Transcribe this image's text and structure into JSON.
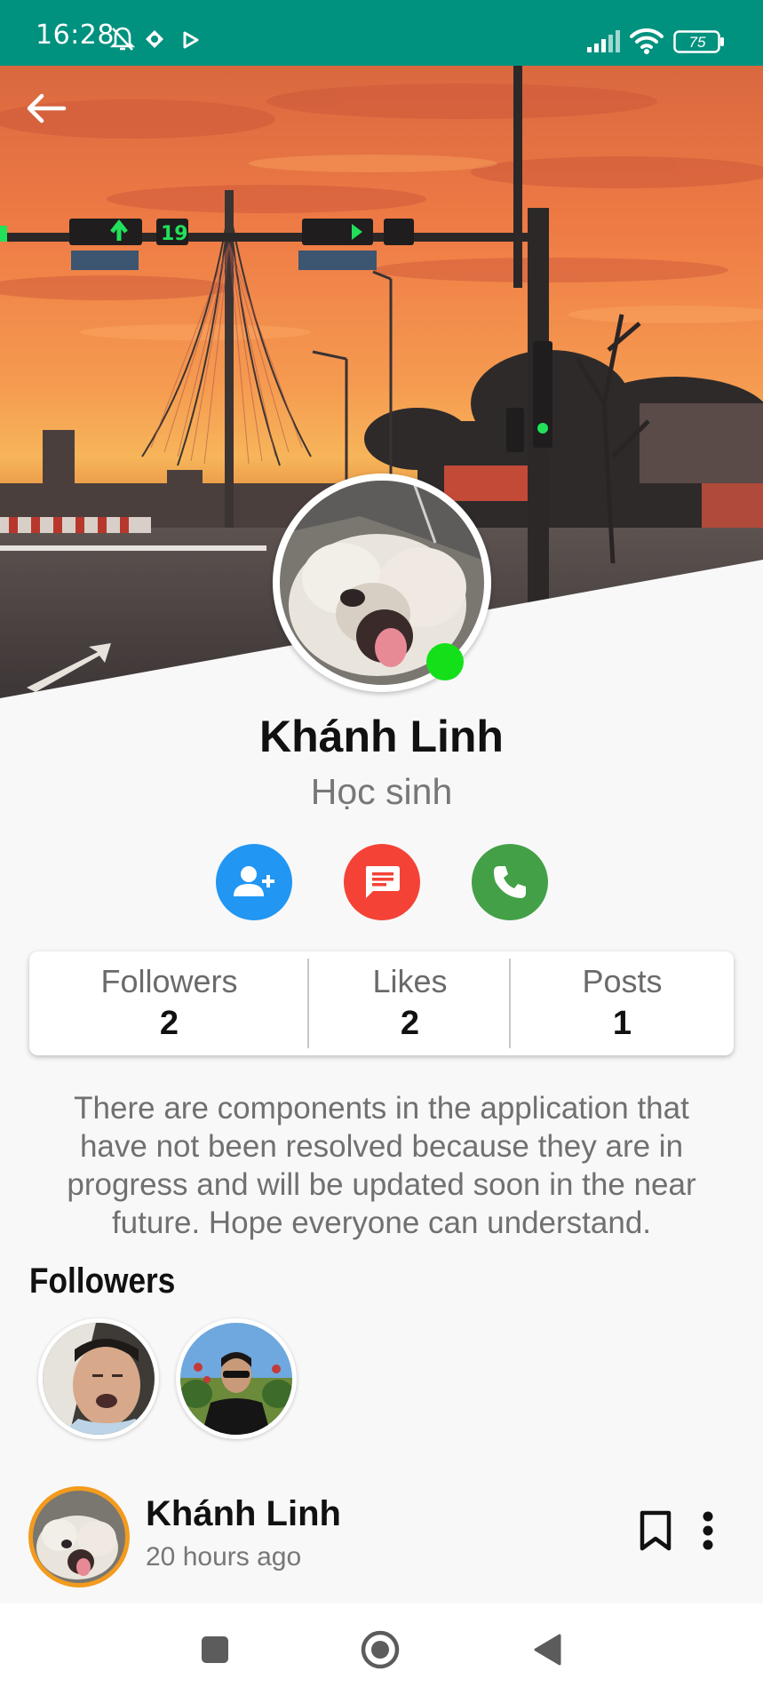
{
  "status_bar": {
    "time": "16:28",
    "battery": "75",
    "background": "#00917f"
  },
  "header": {
    "back_icon": "arrow-left-icon"
  },
  "profile": {
    "name": "Khánh Linh",
    "role": "Học sinh",
    "online": true,
    "online_color": "#14e01a"
  },
  "actions": [
    {
      "name": "follow",
      "icon": "person-add-icon",
      "color": "#2196f3"
    },
    {
      "name": "message",
      "icon": "message-icon",
      "color": "#f44336"
    },
    {
      "name": "call",
      "icon": "phone-icon",
      "color": "#43a047"
    }
  ],
  "stats": [
    {
      "label": "Followers",
      "value": "2"
    },
    {
      "label": "Likes",
      "value": "2"
    },
    {
      "label": "Posts",
      "value": "1"
    }
  ],
  "notice": "There are components in the application that have not been resolved because they are in progress and will be updated soon in the near future. Hope everyone can understand.",
  "followers_section": {
    "title": "Followers",
    "count_shown": 2
  },
  "post": {
    "author": "Khánh Linh",
    "time": "20 hours ago",
    "avatar_ring_color": "#f29b1e",
    "bookmark_icon": "bookmark-icon",
    "more_icon": "more-vertical-icon"
  },
  "nav_bar": {
    "buttons": [
      "recents-square-icon",
      "home-circle-icon",
      "back-triangle-icon"
    ]
  }
}
